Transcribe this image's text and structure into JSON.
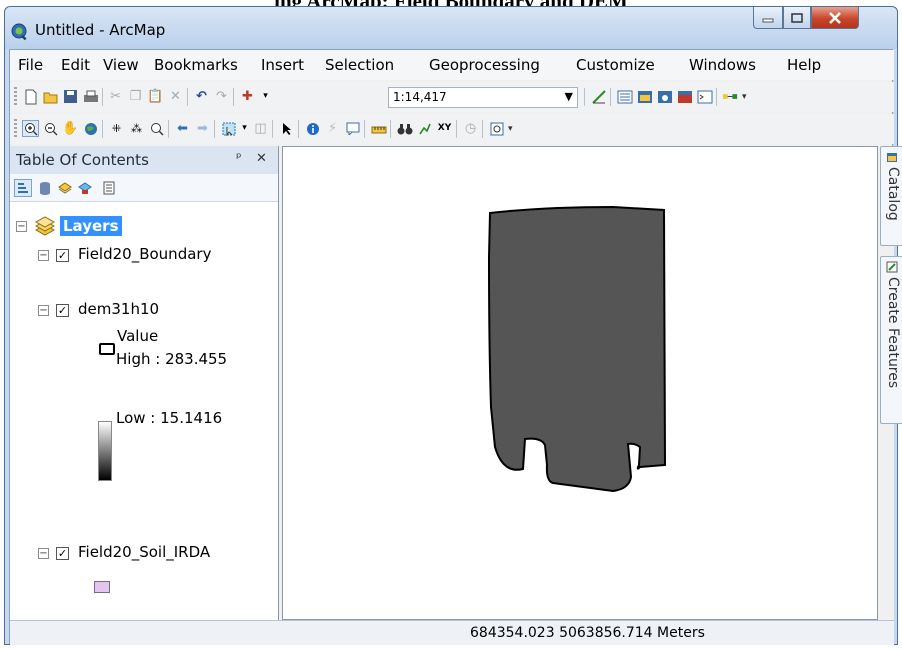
{
  "page_title": "ing ArcMap: Field Boundary and DEM",
  "window": {
    "title": "Untitled - ArcMap"
  },
  "menu": [
    "File",
    "Edit",
    "View",
    "Bookmarks",
    "Insert",
    "Selection",
    "Geoprocessing",
    "Customize",
    "Windows",
    "Help"
  ],
  "toolbar": {
    "scale_value": "1:14,417"
  },
  "toc": {
    "header": "Table Of Contents",
    "root": "Layers",
    "layers": [
      {
        "name": "Field20_Boundary",
        "checked": true
      },
      {
        "name": "dem31h10",
        "checked": true,
        "legend": {
          "title": "Value",
          "high": "High : 283.455",
          "low": "Low : 15.1416"
        }
      },
      {
        "name": "Field20_Soil_IRDA",
        "checked": true,
        "symbol_color": "#e2c6ee"
      }
    ]
  },
  "dock": {
    "tabs": [
      "Catalog",
      "Create Features"
    ]
  },
  "status": {
    "coordinates": "684354.023  5063856.714 Meters"
  },
  "map": {
    "fill_color": "#555555",
    "outline_color": "#000000"
  }
}
